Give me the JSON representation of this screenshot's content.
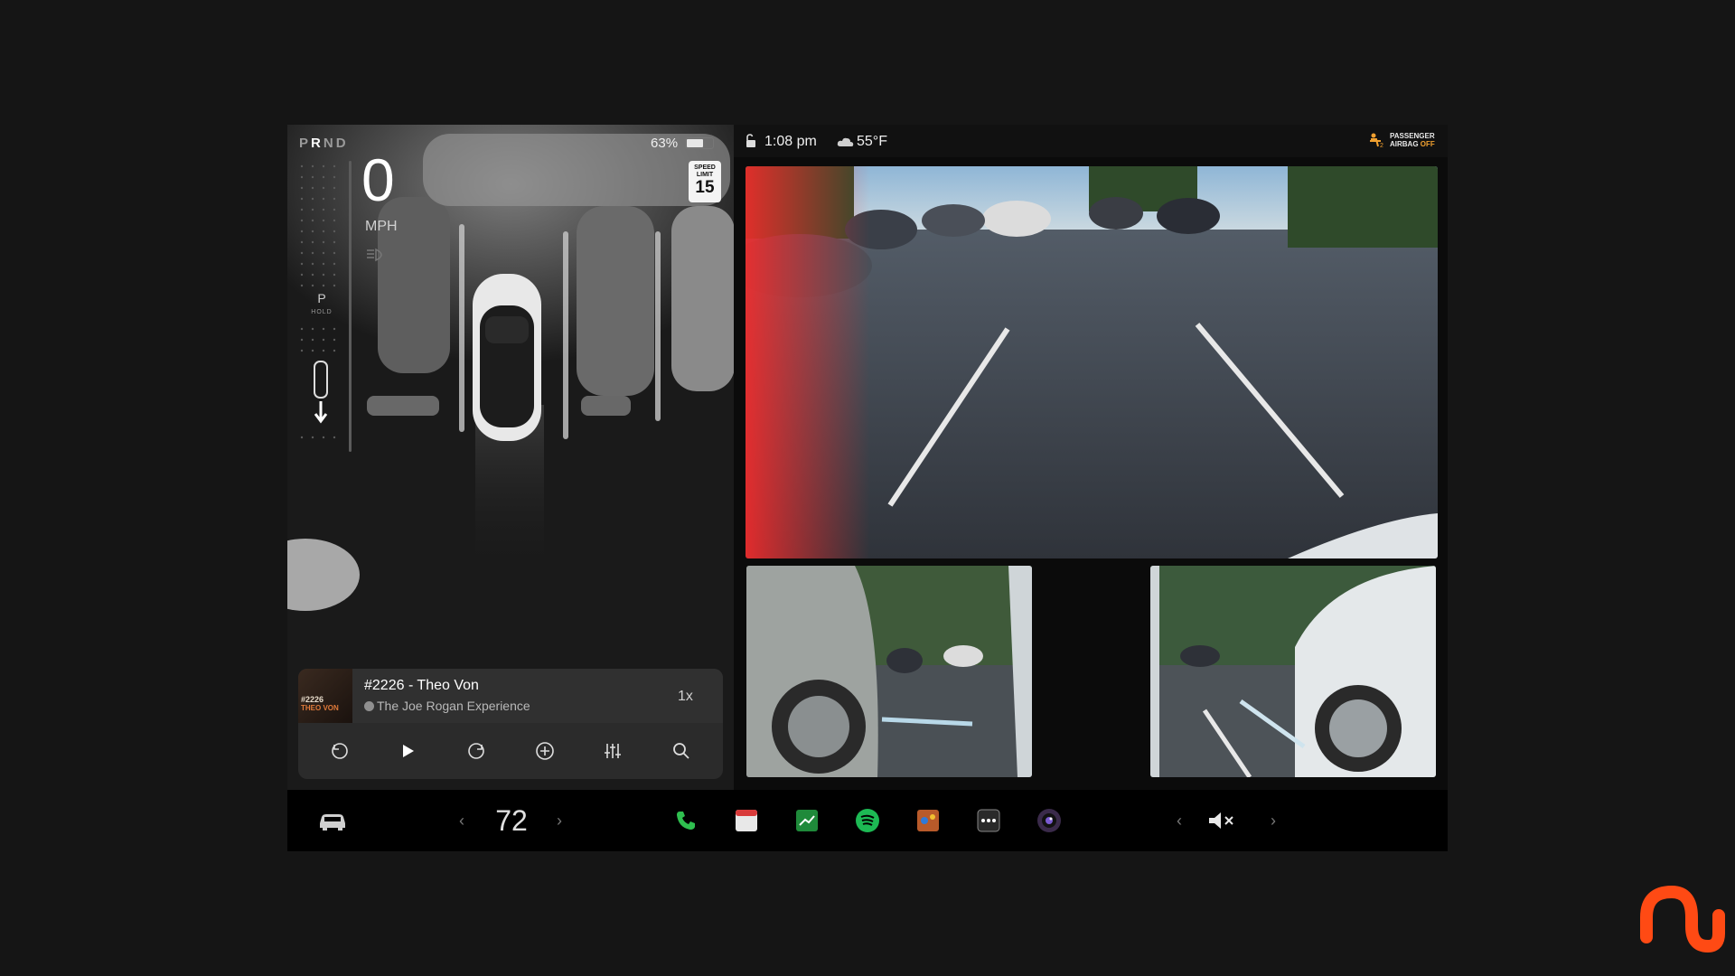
{
  "drive": {
    "gears": [
      "P",
      "R",
      "N",
      "D"
    ],
    "active_gear": "R",
    "battery_percent": "63",
    "battery_unit": "%",
    "battery_fraction": 0.63,
    "speed": "0",
    "speed_unit": "MPH",
    "speed_limit_label": "SPEED LIMIT",
    "speed_limit_value": "15",
    "hold_gear": "P",
    "hold_label": "HOLD"
  },
  "media": {
    "title": "#2226 - Theo Von",
    "show": "The Joe Rogan Experience",
    "playback_rate": "1x",
    "album_text_1": "#2226",
    "album_text_2": "THEO VON"
  },
  "status": {
    "time": "1:08 pm",
    "temperature": "55°F",
    "airbag_line1": "PASSENGER",
    "airbag_line2": "AIRBAG",
    "airbag_state": "OFF"
  },
  "dock": {
    "cabin_temp": "72",
    "apps": [
      "phone-icon",
      "calendar-icon",
      "messages-icon",
      "spotify-icon",
      "games-icon",
      "more-icon",
      "camera-icon"
    ]
  },
  "colors": {
    "airbag_off": "#f0a030",
    "phone": "#2fbf4f",
    "spotify": "#1db954",
    "brand": "#ff4a14"
  }
}
